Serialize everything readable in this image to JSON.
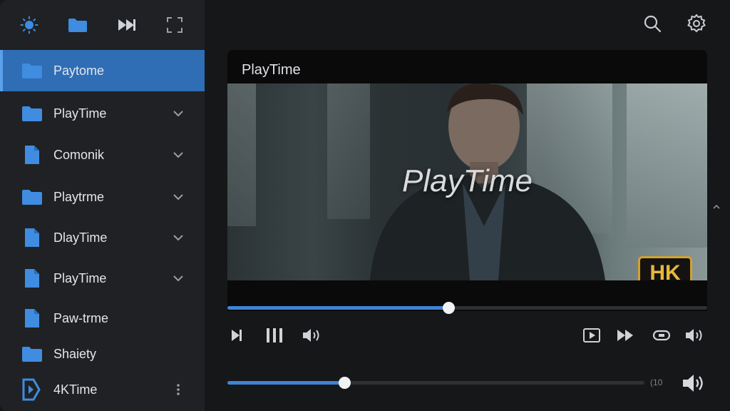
{
  "player": {
    "title": "PlayTime",
    "overlay_title": "PlayTime",
    "badge": "HK",
    "progress": 0.46,
    "volume_bar": 0.28,
    "volume_readout": "(10"
  },
  "sidebar": {
    "items": [
      {
        "label": "Paytome",
        "icon": "folder-icon",
        "active": true,
        "chevron": false
      },
      {
        "label": "PlayTime",
        "icon": "folder-icon",
        "active": false,
        "chevron": true
      },
      {
        "label": "Comonik",
        "icon": "file-icon",
        "active": false,
        "chevron": true
      },
      {
        "label": "Playtrme",
        "icon": "folder-icon",
        "active": false,
        "chevron": true
      },
      {
        "label": "DlayTime",
        "icon": "file-icon",
        "active": false,
        "chevron": true
      },
      {
        "label": "PlayTime",
        "icon": "file-icon",
        "active": false,
        "chevron": true
      },
      {
        "label": "Paw-trme",
        "icon": "file-icon",
        "active": false,
        "chevron": false
      },
      {
        "label": "Shaiety",
        "icon": "folder-icon",
        "active": false,
        "chevron": false
      },
      {
        "label": "4KTime",
        "icon": "play-file-icon",
        "active": false,
        "chevron": false
      }
    ]
  },
  "colors": {
    "accent": "#3d85d6",
    "active_item": "#2f6db5",
    "sidebar_bg": "#1f2124",
    "main_bg": "#161719",
    "badge_gold": "#d3a22d"
  }
}
